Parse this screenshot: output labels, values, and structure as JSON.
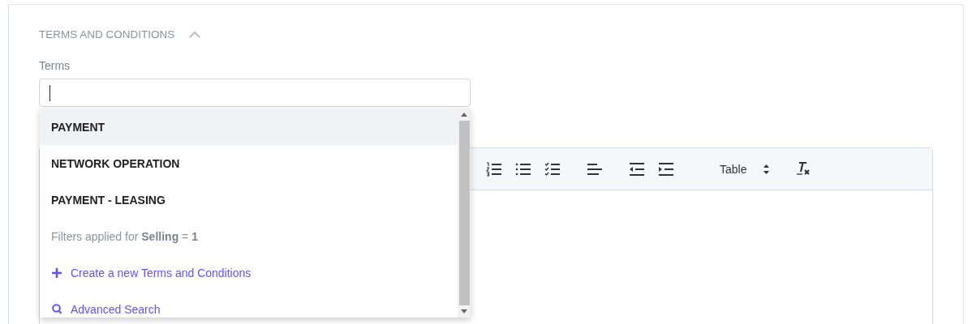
{
  "section": {
    "title": "TERMS AND CONDITIONS",
    "expanded": true
  },
  "terms_field": {
    "label": "Terms"
  },
  "dropdown": {
    "options": [
      {
        "label": "PAYMENT",
        "selected": true
      },
      {
        "label": "NETWORK OPERATION",
        "selected": false
      },
      {
        "label": "PAYMENT - LEASING",
        "selected": false
      }
    ],
    "filter_note": "Filters applied for **Selling** = **1**",
    "actions": [
      {
        "kind": "create",
        "label": "Create a new Terms and Conditions"
      },
      {
        "kind": "search",
        "label": "Advanced Search"
      }
    ]
  },
  "editor": {
    "toolbar_select": "Table"
  }
}
